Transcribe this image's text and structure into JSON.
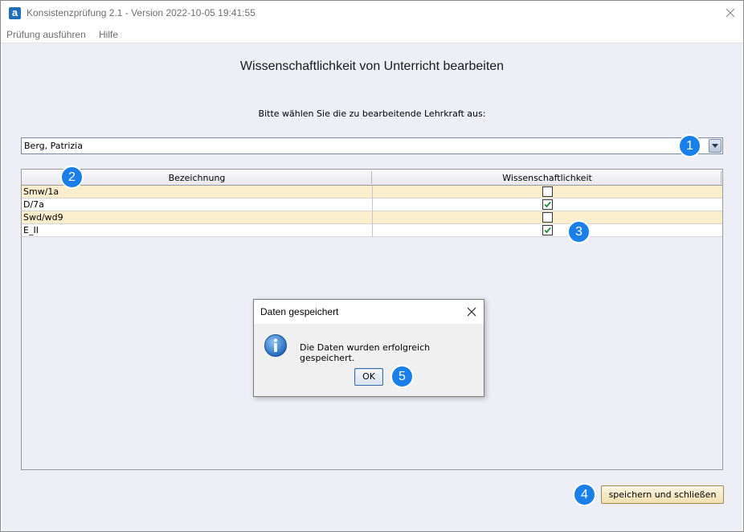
{
  "window": {
    "title": "Konsistenzprüfung 2.1 - Version 2022-10-05 19:41:55",
    "app_logo": "a"
  },
  "menu": {
    "items": [
      "Prüfung ausführen",
      "Hilfe"
    ]
  },
  "main": {
    "heading": "Wissenschaftlichkeit von Unterricht bearbeiten",
    "prompt": "Bitte wählen Sie die zu bearbeitende Lehrkraft aus:",
    "teacher_select": {
      "value": "Berg, Patrizia"
    },
    "table": {
      "columns": [
        "Bezeichnung",
        "Wissenschaftlichkeit"
      ],
      "rows": [
        {
          "name": "Smw/1a",
          "checked": false
        },
        {
          "name": "D/7a",
          "checked": true
        },
        {
          "name": "Swd/wd9",
          "checked": false
        },
        {
          "name": "E_II",
          "checked": true
        }
      ]
    },
    "save_button": "speichern und schließen"
  },
  "dialog": {
    "title": "Daten gespeichert",
    "message": "Die Daten wurden erfolgreich gespeichert.",
    "ok_label": "OK",
    "icon": "info-icon"
  },
  "badges": [
    "1",
    "2",
    "3",
    "4",
    "5"
  ],
  "colors": {
    "badge": "#1a7fe8",
    "row_highlight": "#fbeecc",
    "panel_bg": "#eeeef7",
    "save_button": "#f1dfae"
  }
}
